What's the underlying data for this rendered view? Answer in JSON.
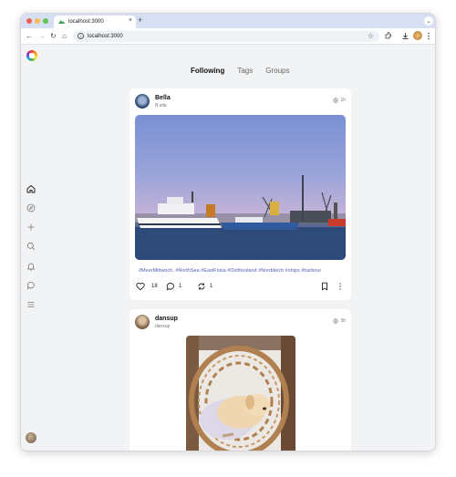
{
  "browser": {
    "tab_title": "localhost:3000",
    "tab_close": "×",
    "new_tab": "+",
    "tab_menu": "⌄",
    "url": "localhost:3000",
    "back": "←",
    "forward": "→",
    "reload": "↻",
    "home": "⌂",
    "bookmark_star": "☆"
  },
  "feed_tabs": {
    "following": "Following",
    "tags": "Tags",
    "groups": "Groups"
  },
  "posts": [
    {
      "username": "Bella",
      "handle": "B.ella",
      "time": "1h",
      "hashtags": "#MeerMittwoch, #NorthSea #EastFrisia #Ostfriesland #Norddeich #ships #harbour",
      "likes": "18",
      "comments": "1",
      "reposts": "1"
    },
    {
      "username": "dansup",
      "handle": "dansup",
      "time": "3h"
    }
  ],
  "colors": {
    "accent": "#5560b8",
    "background": "#f2f3f5"
  }
}
